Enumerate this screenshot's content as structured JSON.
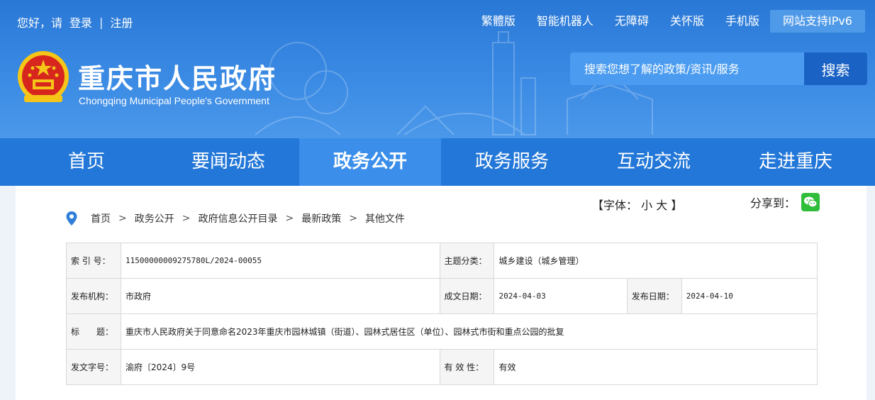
{
  "topbar": {
    "greeting": "您好，请",
    "login": "登录",
    "divider": "|",
    "register": "注册",
    "links": [
      "繁體版",
      "智能机器人",
      "无障碍",
      "关怀版",
      "手机版",
      "网站支持IPv6"
    ]
  },
  "header": {
    "title": "重庆市人民政府",
    "subtitle": "Chongqing Municipal People's Government"
  },
  "search": {
    "placeholder": "搜索您想了解的政策/资讯/服务",
    "button": "搜索"
  },
  "nav": {
    "items": [
      "首页",
      "要闻动态",
      "政务公开",
      "政务服务",
      "互动交流",
      "走进重庆"
    ],
    "active_index": 2
  },
  "tools": {
    "font_prefix": "【字体：",
    "font_small": "小",
    "font_large": "大",
    "font_suffix": "】",
    "share_label": "分享到：",
    "share_icon": "wechat-icon"
  },
  "breadcrumb": [
    "首页",
    "政务公开",
    "政府信息公开目录",
    "最新政策",
    "其他文件"
  ],
  "meta": {
    "index_no_label": "索 引 号：",
    "index_no": "11500000009275780L/2024-00055",
    "topic_label": "主题分类：",
    "topic": "城乡建设（城乡管理）",
    "org_label": "发布机构：",
    "org": "市政府",
    "written_label": "成文日期：",
    "written": "2024-04-03",
    "publish_label": "发布日期：",
    "publish": "2024-04-10",
    "title_label": "标　　题：",
    "title": "重庆市人民政府关于同意命名2023年重庆市园林城镇（街道）、园林式居住区（单位）、园林式市街和重点公园的批复",
    "docno_label": "发文字号：",
    "docno": "渝府〔2024〕9号",
    "validity_label": "有 效 性：",
    "validity": "有效"
  },
  "colors": {
    "header_blue": "#2a78d6",
    "nav_blue": "#2277d8",
    "nav_active": "#3b8fea",
    "search_button": "#1a62c4",
    "wechat_green": "#2fbd3a",
    "emblem_red": "#d7261e",
    "emblem_gold": "#f5c518"
  }
}
